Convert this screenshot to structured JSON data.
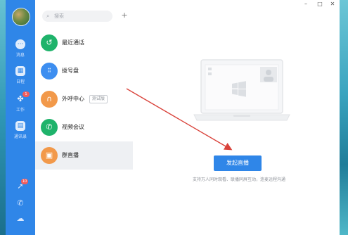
{
  "rail": {
    "items": [
      {
        "label": "消息",
        "icon": "chat-bubble-icon"
      },
      {
        "label": "日程",
        "icon": "calendar-icon"
      },
      {
        "label": "工作",
        "icon": "workbench-grid-icon",
        "badge": "1"
      },
      {
        "label": "通讯录",
        "icon": "contacts-icon"
      }
    ],
    "bottom": [
      {
        "icon": "rocket-icon",
        "badge": "10"
      },
      {
        "icon": "phone-icon"
      },
      {
        "icon": "cloud-icon"
      }
    ]
  },
  "search": {
    "placeholder": "搜索",
    "add_label": "+"
  },
  "list": {
    "items": [
      {
        "label": "最近通话",
        "icon": "recent-calls-icon",
        "color": "#1fb36b"
      },
      {
        "label": "拨号盘",
        "icon": "dialpad-icon",
        "color": "#3d8ef0"
      },
      {
        "label": "外呼中心",
        "icon": "headset-icon",
        "color": "#f2994a",
        "tag": "测试版"
      },
      {
        "label": "视频会议",
        "icon": "video-call-icon",
        "color": "#1fb36b"
      },
      {
        "label": "群直播",
        "icon": "live-broadcast-icon",
        "color": "#f2994a",
        "active": true
      }
    ]
  },
  "window_controls": {
    "minimize": "–",
    "maximize": "□",
    "close": "✕"
  },
  "main": {
    "button_label": "发起直播",
    "description": "支持万人同时观看、联播同屏互动，连麦远程沟通"
  },
  "colors": {
    "accent": "#2f86e8",
    "annotation_arrow": "#d9423a"
  }
}
